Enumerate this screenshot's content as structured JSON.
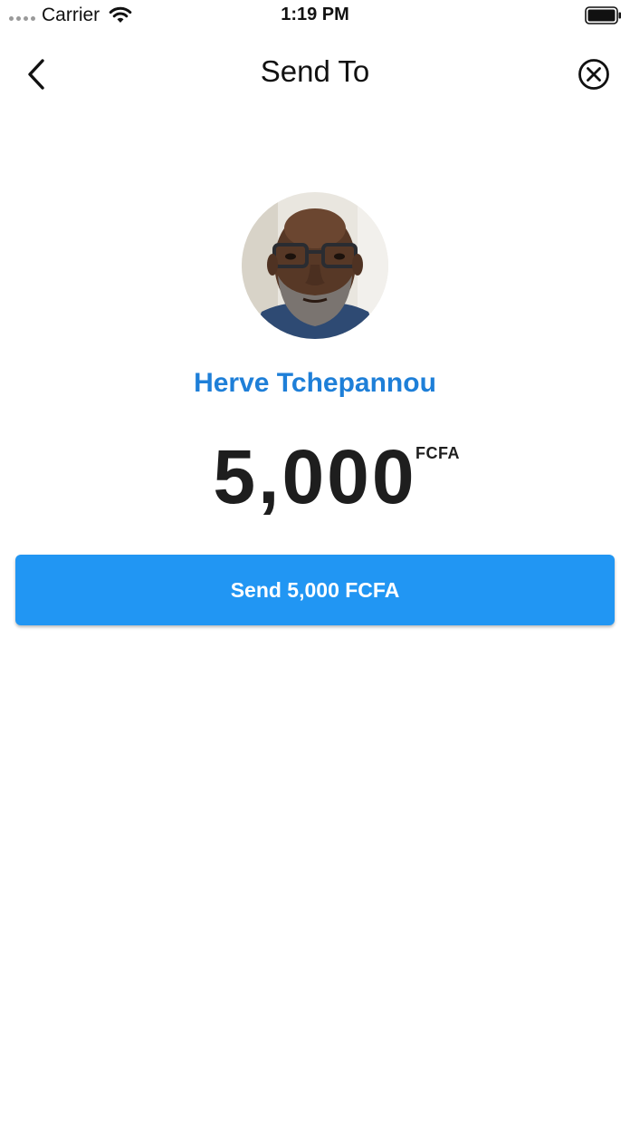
{
  "status_bar": {
    "carrier": "Carrier",
    "time": "1:19 PM",
    "icons": [
      "signal-dots-icon",
      "wifi-icon",
      "battery-icon"
    ]
  },
  "nav": {
    "title": "Send To",
    "back_icon": "chevron-left-icon",
    "close_icon": "close-circle-icon"
  },
  "recipient": {
    "name": "Herve Tchepannou",
    "avatar": "avatar-photo"
  },
  "amount": {
    "value": "5,000",
    "currency": "FCFA"
  },
  "send_button": {
    "label": "Send 5,000 FCFA"
  },
  "colors": {
    "accent": "#2196f3",
    "name_blue": "#1e7fd8",
    "text_dark": "#1e1e1e",
    "background": "#ffffff"
  }
}
